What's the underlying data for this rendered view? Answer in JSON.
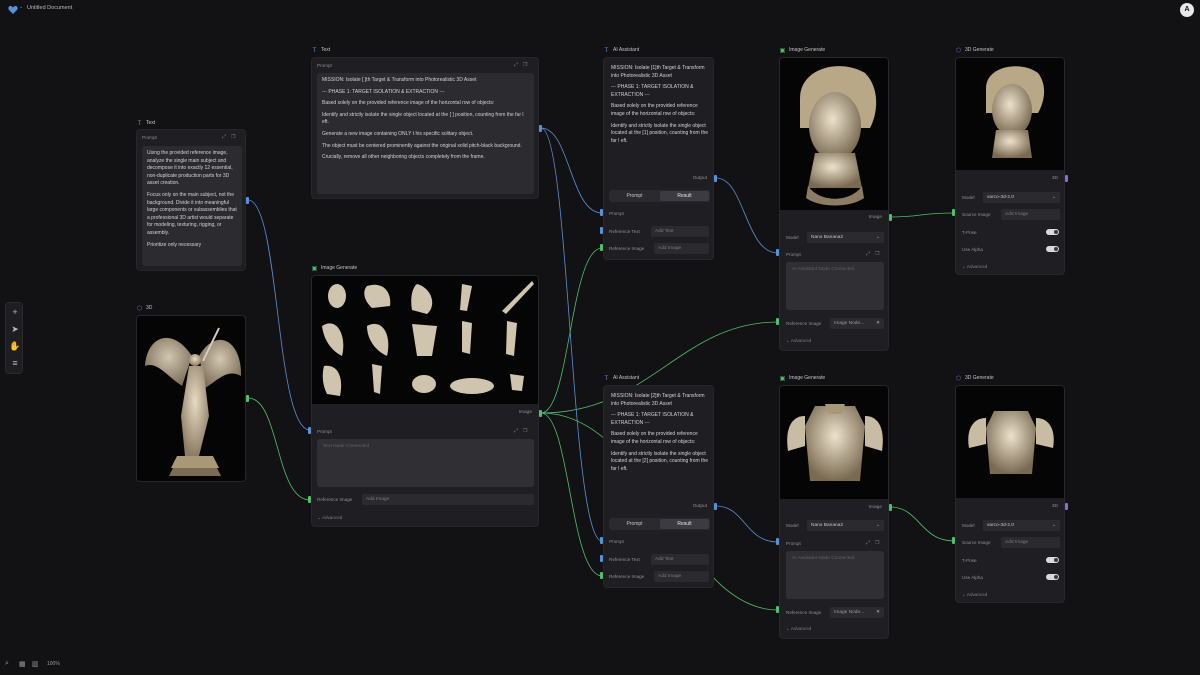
{
  "app": {
    "doc_title": "Untitled Document",
    "avatar": "A",
    "zoom": "100%"
  },
  "colors": {
    "background": "#121214",
    "node": "#1f1f23",
    "wire_blue": "#5b8fd6",
    "wire_green": "#4fbf6a",
    "port_purple": "#8a6bd6"
  },
  "icons": {
    "logo": "heart-logo-icon",
    "text_node": "text-t-icon",
    "image_node": "image-icon",
    "model_node": "cube-icon"
  },
  "nodes": {
    "text_left": {
      "title": "Text",
      "prompt_label": "Prompt",
      "paragraphs": [
        "Using the provided reference image, analyze the single main subject and decompose it into exactly 12 essential, non-duplicate production parts for 3D asset creation.",
        "Focus only on the main subject, not the background. Divide it into meaningful large components or subassemblies that a professional 3D artist would separate for modeling, texturing, rigging, or assembly.",
        "Prioritize only necessary"
      ]
    },
    "text_mid": {
      "title": "Text",
      "prompt_label": "Prompt",
      "paragraphs": [
        "MISSION: Isolate [ ]th Target & Transform into Photorealistic 3D Asset",
        "--- PHASE 1: TARGET ISOLATION & EXTRACTION ---",
        "Based solely on the provided reference image of the horizontal row of objects:",
        "Identify and strictly isolate the single object located at the [ ] position, counting from the far l eft.",
        "Generate a new image containing ONLY t his specific solitary object.",
        "The object must be centered prominently against the original solid pitch-black background.",
        "Crucially, remove all other neighboring objects completely from the frame."
      ]
    },
    "model_left": {
      "title": "3D"
    },
    "image_gen_mid": {
      "title": "Image Generate",
      "image_label": "Image",
      "prompt_label": "Prompt",
      "prompt_placeholder": "Text Node Connected",
      "ref_label": "Reference Image",
      "ref_placeholder": "Add Image",
      "advanced": "Advanced"
    },
    "ai_top": {
      "title": "AI Assistant",
      "paragraphs": [
        "MISSION: Isolate [1]th Target & Transform into Photorealistic 3D Asset",
        "--- PHASE 1: TARGET ISOLATION & EXTRACTION ---",
        "Based solely on the provided reference image of the horizontal row of objects:",
        "Identify and strictly isolate the single object located at the [1] position, counting from the far l eft."
      ],
      "tab_prompt": "Prompt",
      "tab_result": "Result",
      "output_label": "Output",
      "prompt_label": "Prompt",
      "ref_text_label": "Reference Text",
      "ref_text_placeholder": "Add Text",
      "ref_image_label": "Reference Image",
      "ref_image_placeholder": "Add Image"
    },
    "ai_bottom": {
      "title": "AI Assistant",
      "paragraphs": [
        "MISSION: Isolate [2]th Target & Transform into Photorealistic 3D Asset",
        "--- PHASE 1: TARGET ISOLATION & EXTRACTION ---",
        "Based solely on the provided reference image of the horizontal row of objects:",
        "Identify and strictly isolate the single object located at the [2] position, counting from the far l eft."
      ],
      "tab_prompt": "Prompt",
      "tab_result": "Result",
      "output_label": "Output",
      "prompt_label": "Prompt",
      "ref_text_label": "Reference Text",
      "ref_text_placeholder": "Add Text",
      "ref_image_label": "Reference Image",
      "ref_image_placeholder": "Add Image"
    },
    "img_top": {
      "title": "Image Generate",
      "image_label": "Image",
      "model_label": "Model",
      "model_value": "Nano Banana2",
      "prompt_label": "Prompt",
      "prompt_placeholder": "AI Assistant Node Connected",
      "ref_label": "Reference Image",
      "ref_value": "Image Node...",
      "advanced": "Advanced"
    },
    "img_bottom": {
      "title": "Image Generate",
      "image_label": "Image",
      "model_label": "Model",
      "model_value": "Nano Banana2",
      "prompt_label": "Prompt",
      "prompt_placeholder": "AI Assistant Node Connected",
      "ref_label": "Reference Image",
      "ref_value": "Image Node...",
      "advanced": "Advanced"
    },
    "g3d_top": {
      "title": "3D Generate",
      "out_label": "3D",
      "model_label": "Model",
      "model_value": "varco-3d-2.0",
      "source_label": "Source Image",
      "source_placeholder": "Add Image",
      "tpose_label": "T-Pose",
      "alpha_label": "Use Alpha",
      "advanced": "Advanced"
    },
    "g3d_bottom": {
      "title": "3D Generate",
      "out_label": "3D",
      "model_label": "Model",
      "model_value": "varco-3d-2.0",
      "source_label": "Source Image",
      "source_placeholder": "Add Image",
      "tpose_label": "T-Pose",
      "alpha_label": "Use Alpha",
      "advanced": "Advanced"
    }
  }
}
